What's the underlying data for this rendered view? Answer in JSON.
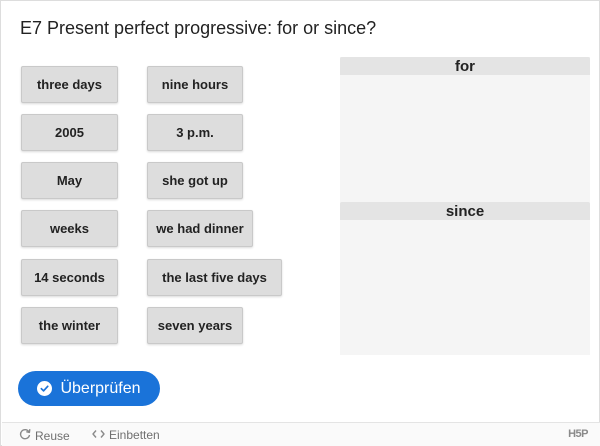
{
  "title": "E7 Present perfect progressive: for or since?",
  "draggables": [
    {
      "label": "three days"
    },
    {
      "label": "nine hours"
    },
    {
      "label": "2005"
    },
    {
      "label": "3 p.m."
    },
    {
      "label": "May"
    },
    {
      "label": "she got up"
    },
    {
      "label": "weeks"
    },
    {
      "label": "we had dinner"
    },
    {
      "label": "14 seconds"
    },
    {
      "label": "the last five days"
    },
    {
      "label": "the winter"
    },
    {
      "label": "seven years"
    }
  ],
  "dropzones": [
    {
      "label": "for"
    },
    {
      "label": "since"
    }
  ],
  "check_button": {
    "label": "Überprüfen",
    "icon": "check-circle-icon",
    "color": "#1a73d9"
  },
  "footer": {
    "reuse_label": "Reuse",
    "embed_label": "Einbetten",
    "logo_text": "H5P"
  }
}
